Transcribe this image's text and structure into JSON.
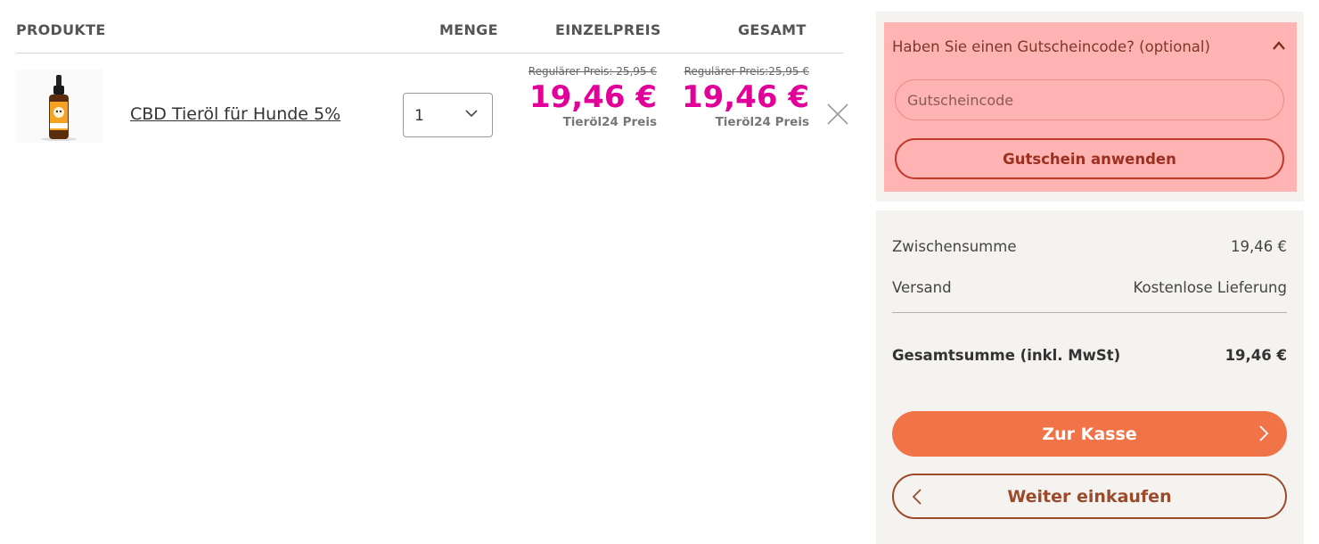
{
  "cart": {
    "headers": {
      "products": "PRODUKTE",
      "quantity": "MENGE",
      "unit_price": "EINZELPREIS",
      "total": "GESAMT"
    },
    "items": [
      {
        "name": "CBD Tieröl für Hunde 5%",
        "thumbnail_label": "Tieröl",
        "quantity": "1",
        "unit_price": {
          "regular": "Regulärer Preis: 25,95 €",
          "current": "19,46 €",
          "note": "Tieröl24 Preis"
        },
        "total_price": {
          "regular": "Regulärer Preis:25,95 €",
          "current": "19,46 €",
          "note": "Tieröl24 Preis"
        }
      }
    ]
  },
  "coupon": {
    "title": "Haben Sie einen Gutscheincode? (optional)",
    "placeholder": "Gutscheincode",
    "apply_label": "Gutschein anwenden"
  },
  "summary": {
    "subtotal_label": "Zwischensumme",
    "subtotal_value": "19,46 €",
    "shipping_label": "Versand",
    "shipping_value": "Kostenlose Lieferung",
    "total_label": "Gesamtsumme (inkl. MwSt)",
    "total_value": "19,46 €",
    "checkout_label": "Zur Kasse",
    "continue_label": "Weiter einkaufen"
  },
  "colors": {
    "sale_price": "#e10098",
    "checkout_button": "#f07448",
    "coupon_panel": "#ffb3b3",
    "sidebar_background": "#f5f3f0"
  },
  "icons": {
    "quantity_dropdown": "chevron-down-icon",
    "remove_item": "close-icon",
    "coupon_toggle": "chevron-up-icon",
    "checkout_arrow": "chevron-right-icon",
    "continue_arrow": "chevron-left-icon"
  }
}
